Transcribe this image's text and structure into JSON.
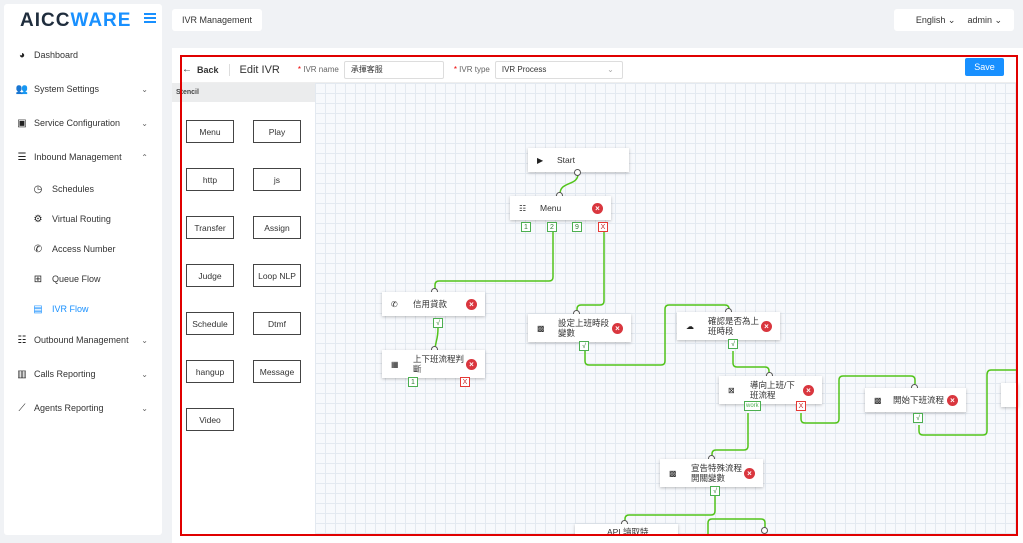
{
  "brand": {
    "part1": "AICC",
    "part2": "WARE"
  },
  "sidebar": {
    "items": [
      {
        "label": "Dashboard",
        "icon": "dashboard-icon"
      },
      {
        "label": "System Settings",
        "icon": "users-icon"
      },
      {
        "label": "Service Configuration",
        "icon": "id-card-icon"
      },
      {
        "label": "Inbound Management",
        "icon": "list-icon"
      },
      {
        "label": "Schedules",
        "icon": "clock-icon"
      },
      {
        "label": "Virtual Routing",
        "icon": "gear-icon"
      },
      {
        "label": "Access Number",
        "icon": "phone-icon"
      },
      {
        "label": "Queue Flow",
        "icon": "queue-icon"
      },
      {
        "label": "IVR Flow",
        "icon": "ivr-icon"
      },
      {
        "label": "Outbound Management",
        "icon": "table-icon"
      },
      {
        "label": "Calls Reporting",
        "icon": "bar-chart-icon"
      },
      {
        "label": "Agents Reporting",
        "icon": "line-chart-icon"
      }
    ]
  },
  "topbar": {
    "tab": "IVR Management",
    "language": "English",
    "user": "admin"
  },
  "editor": {
    "back": "Back",
    "title": "Edit IVR",
    "name_label": "IVR name",
    "name_value": "承揮客服",
    "type_label": "IVR type",
    "type_value": "IVR Process",
    "save": "Save",
    "accent": "#1890ff"
  },
  "stencil": {
    "header": "Stencil",
    "items": [
      "Menu",
      "Play",
      "http",
      "js",
      "Transfer",
      "Assign",
      "Judge",
      "Loop NLP",
      "Schedule",
      "Dtmf",
      "hangup",
      "Message",
      "Video"
    ]
  },
  "flow": {
    "nodes": {
      "start": "Start",
      "menu": "Menu",
      "credit_loan": "信用貸款",
      "set_work_time": "設定上班時段變數",
      "check_work_time": "確認是否為上班時段",
      "work_flow_judge": "上下班流程判斷",
      "route_flow": "導向上班/下班流程",
      "start_off_flow": "開始下班流程",
      "special_flow": "宣告特殊流程開關變數",
      "api_fetch": "API 讀取特"
    },
    "options": {
      "menu_1": "1",
      "menu_2": "2",
      "menu_9": "9",
      "menu_x": "X",
      "check": "√",
      "judge_1": "1",
      "judge_x": "X",
      "route_work": "work",
      "route_x": "X"
    }
  }
}
